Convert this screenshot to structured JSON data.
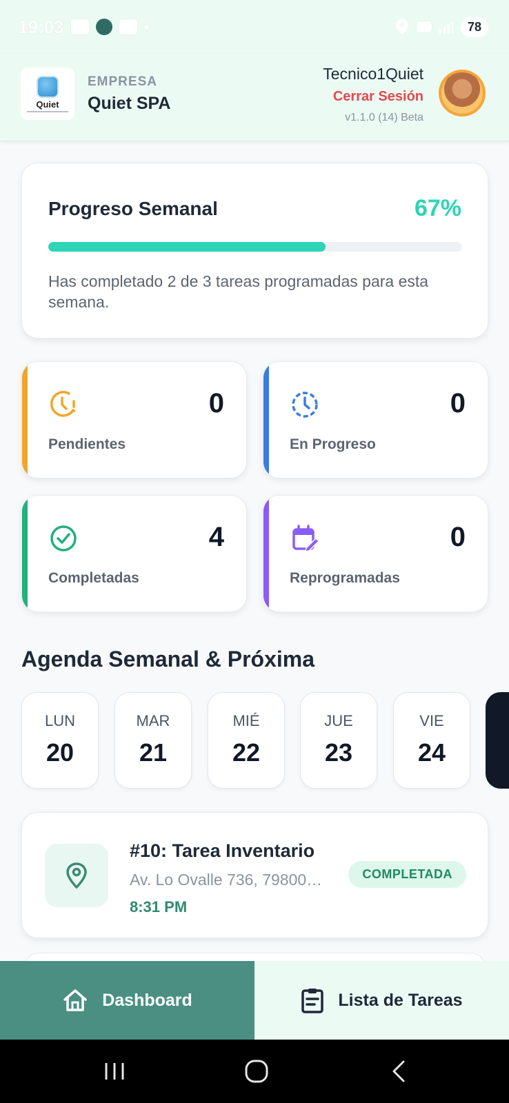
{
  "status_bar": {
    "time": "19:03",
    "battery": "78"
  },
  "header": {
    "logo_text": "Quiet",
    "company_label": "EMPRESA",
    "company_name": "Quiet SPA",
    "user_name": "Tecnico1Quiet",
    "logout_label": "Cerrar Sesión",
    "version": "v1.1.0 (14) Beta"
  },
  "progress": {
    "title": "Progreso Semanal",
    "percent_label": "67%",
    "fill_fraction": 0.67,
    "description": "Has completado 2 de 3 tareas programadas para esta semana.",
    "color": "#2dd4b5"
  },
  "stats": [
    {
      "label": "Pendientes",
      "value": "0",
      "icon": "clock-alert-icon",
      "color": "#f0a52b"
    },
    {
      "label": "En Progreso",
      "value": "0",
      "icon": "clock-progress-icon",
      "color": "#3b7ddd"
    },
    {
      "label": "Completadas",
      "value": "4",
      "icon": "check-circle-icon",
      "color": "#22b07d"
    },
    {
      "label": "Reprogramadas",
      "value": "0",
      "icon": "calendar-edit-icon",
      "color": "#8b5cf6"
    }
  ],
  "agenda": {
    "title": "Agenda Semanal & Próxima",
    "days": [
      {
        "name": "LUN",
        "num": "20"
      },
      {
        "name": "MAR",
        "num": "21"
      },
      {
        "name": "MIÉ",
        "num": "22"
      },
      {
        "name": "JUE",
        "num": "23"
      },
      {
        "name": "VIE",
        "num": "24"
      }
    ]
  },
  "task": {
    "title": "#10: Tarea Inventario",
    "address": "Av. Lo Ovalle 736, 79800…",
    "time": "8:31 PM",
    "status": "COMPLETADA",
    "icon": "location-pin-icon"
  },
  "bottom_nav": {
    "dashboard": "Dashboard",
    "tasks": "Lista de Tareas",
    "active_color": "#4a8f82"
  }
}
